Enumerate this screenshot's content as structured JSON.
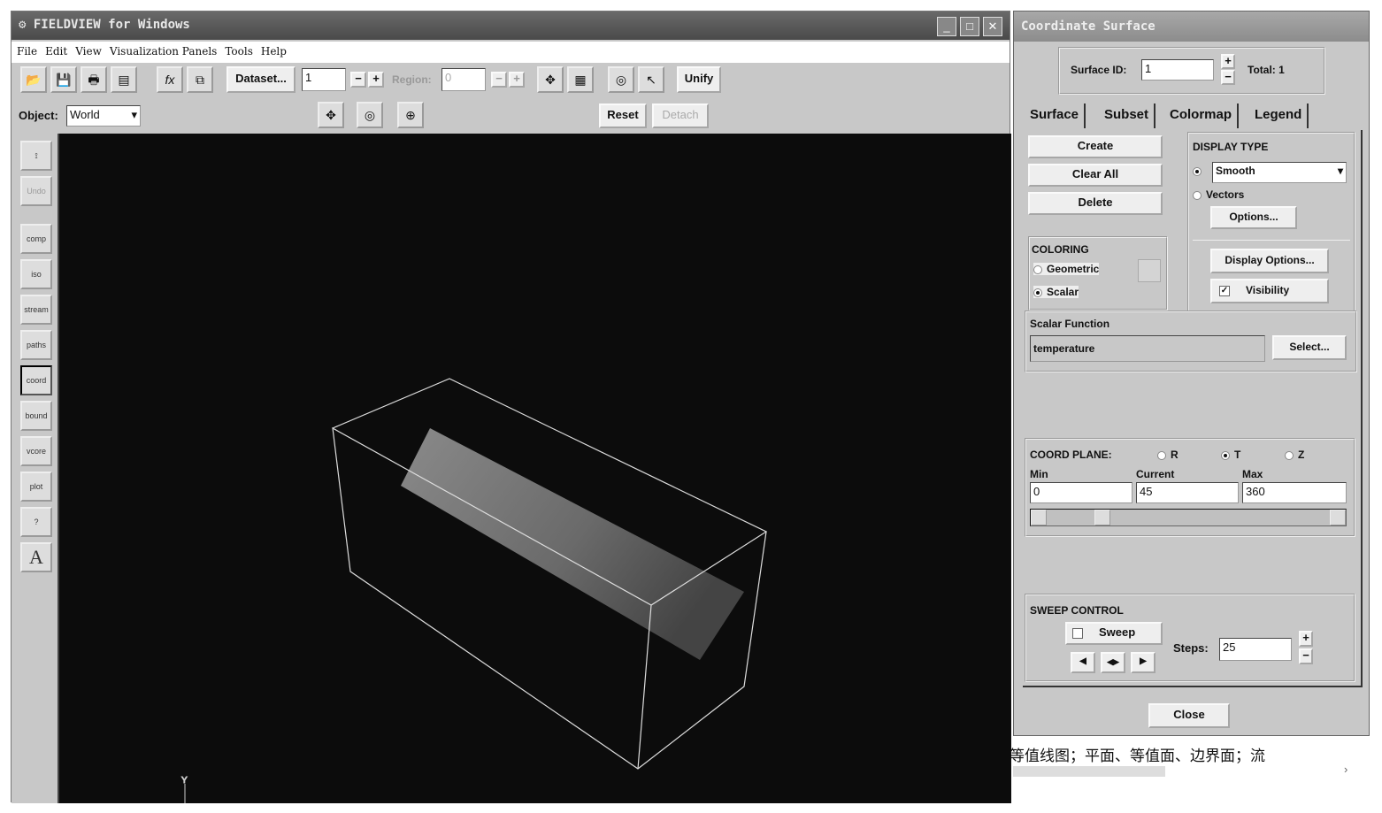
{
  "main_window": {
    "title": "FIELDVIEW for Windows",
    "menu": [
      "File",
      "Edit",
      "View",
      "Visualization Panels",
      "Tools",
      "Help"
    ],
    "toolbar": {
      "dataset_label": "Dataset...",
      "dataset_value": "1",
      "region_label": "Region:",
      "region_value": "0",
      "unify_label": "Unify"
    },
    "object_row": {
      "object_label": "Object:",
      "object_value": "World",
      "reset_label": "Reset",
      "detach_label": "Detach"
    },
    "left_tools": [
      "",
      "Undo",
      "comp",
      "iso",
      "stream",
      "paths",
      "coord",
      "bound",
      "vcore",
      "plot",
      "?",
      "A"
    ]
  },
  "panel": {
    "title": "Coordinate Surface",
    "surface_id_label": "Surface ID:",
    "surface_id_value": "1",
    "total_label": "Total:",
    "total_value": "1",
    "tabs": [
      "Surface",
      "Subset",
      "Colormap",
      "Legend"
    ],
    "create": "Create",
    "clear_all": "Clear All",
    "delete": "Delete",
    "display_type_label": "DISPLAY TYPE",
    "display_type_value": "Smooth",
    "vectors_label": "Vectors",
    "options_label": "Options...",
    "coloring_label": "COLORING",
    "geometric_label": "Geometric",
    "scalar_label": "Scalar",
    "display_options_label": "Display Options...",
    "visibility_label": "Visibility",
    "scalar_function_label": "Scalar Function",
    "scalar_function_value": "temperature",
    "select_label": "Select...",
    "coord_plane_label": "COORD PLANE:",
    "plane_options": [
      "R",
      "T",
      "Z"
    ],
    "plane_selected": "T",
    "min_label": "Min",
    "current_label": "Current",
    "max_label": "Max",
    "min_value": "0",
    "current_value": "45",
    "max_value": "360",
    "slider_fraction": 0.125,
    "sweep_control_label": "SWEEP CONTROL",
    "sweep_label": "Sweep",
    "steps_label": "Steps:",
    "steps_value": "25",
    "close_label": "Close"
  },
  "background_text": "等值线图；平面、等值面、边界面；流"
}
